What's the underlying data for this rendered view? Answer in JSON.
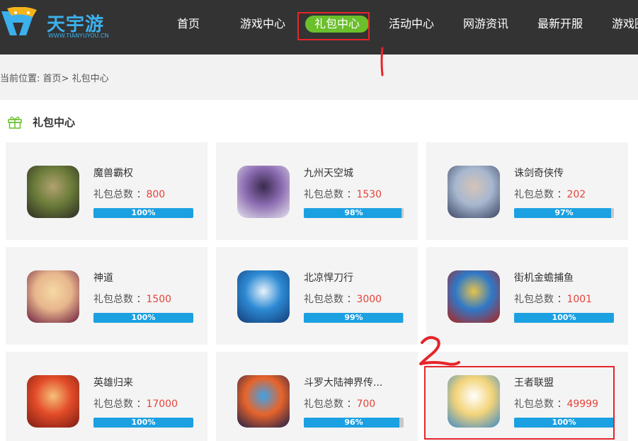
{
  "site": {
    "logo_text": "天宇游",
    "logo_url": "WWW.TIANYUYOU.CN"
  },
  "nav": {
    "items": [
      "首页",
      "游戏中心",
      "礼包中心",
      "活动中心",
      "网游资讯",
      "最新开服",
      "游戏圈"
    ],
    "active_index": 2,
    "active_color": "#6abf2b"
  },
  "breadcrumb": {
    "prefix": "当前位置: ",
    "home": "首页",
    "separator": "> ",
    "current": "礼包中心"
  },
  "section": {
    "title": "礼包中心",
    "icon": "gift-icon"
  },
  "gift_label": "礼包总数 ：",
  "games": [
    {
      "name": "魔兽霸权",
      "count": "800",
      "progress_label": "100%",
      "progress": 100,
      "icon": "orc-game-icon"
    },
    {
      "name": "九州天空城",
      "count": "1530",
      "progress_label": "98%",
      "progress": 98,
      "icon": "sky-city-game-icon"
    },
    {
      "name": "诛剑奇侠传",
      "count": "202",
      "progress_label": "97%",
      "progress": 97,
      "icon": "swordswoman-game-icon"
    },
    {
      "name": "神道",
      "count": "1500",
      "progress_label": "100%",
      "progress": 100,
      "icon": "goddess-game-icon"
    },
    {
      "name": "北凉悍刀行",
      "count": "3000",
      "progress_label": "99%",
      "progress": 99,
      "icon": "blade-game-icon"
    },
    {
      "name": "街机金蟾捕鱼",
      "count": "1001",
      "progress_label": "100%",
      "progress": 100,
      "icon": "shark-game-icon"
    },
    {
      "name": "英雄归来",
      "count": "17000",
      "progress_label": "100%",
      "progress": 100,
      "icon": "fire-heroine-game-icon"
    },
    {
      "name": "斗罗大陆神界传...",
      "count": "700",
      "progress_label": "96%",
      "progress": 96,
      "icon": "douluo-game-icon"
    },
    {
      "name": "王者联盟",
      "count": "49999",
      "progress_label": "100%",
      "progress": 100,
      "icon": "blonde-hero-game-icon"
    }
  ],
  "colors": {
    "header_bg": "#333333",
    "progress_fill": "#1ba0e2",
    "count_red": "#e5433a",
    "annotation_red": "#e5252a"
  }
}
